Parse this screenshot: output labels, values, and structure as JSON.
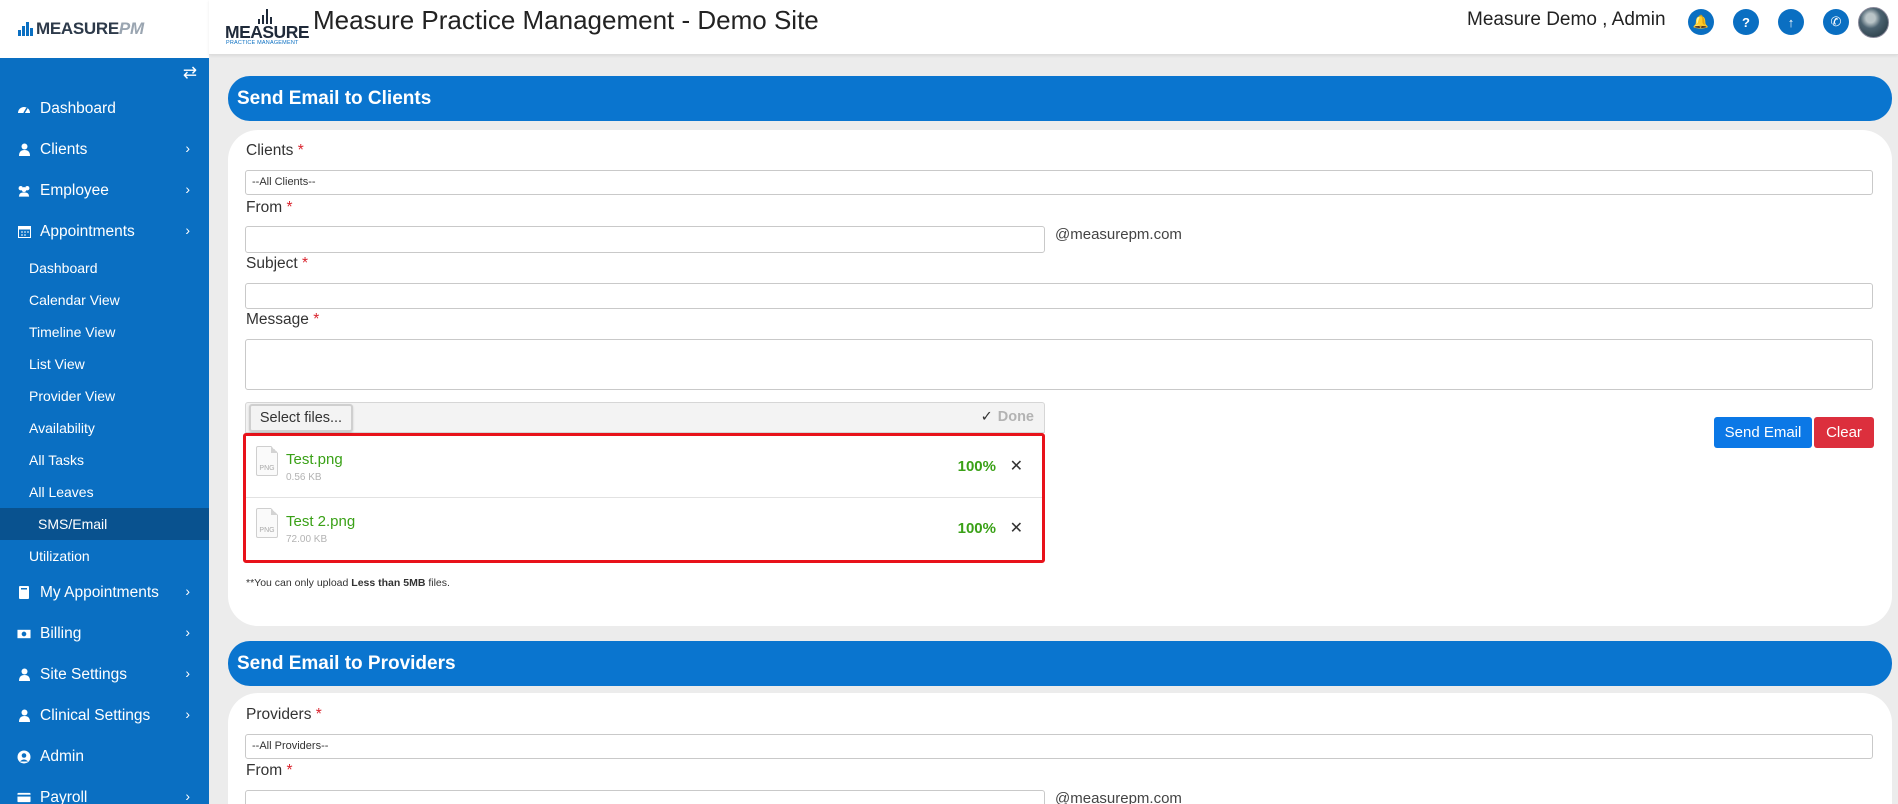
{
  "app": {
    "sidebar_logo_main": "MEASURE",
    "sidebar_logo_accent": "PM",
    "header_logo_main": "MEASURE",
    "header_logo_sub": "PRACTICE MANAGEMENT",
    "title": "Measure Practice Management - Demo Site",
    "user": "Measure Demo , Admin"
  },
  "header_icons": [
    {
      "icon": "bell-icon",
      "glyph": "🔔"
    },
    {
      "icon": "help-icon",
      "glyph": "?"
    },
    {
      "icon": "upload-icon",
      "glyph": "↑"
    },
    {
      "icon": "phone-icon",
      "glyph": "✆"
    }
  ],
  "sidebar": {
    "items": [
      {
        "label": "Dashboard",
        "icon": "dashboard-icon"
      },
      {
        "label": "Clients",
        "icon": "user-icon"
      },
      {
        "label": "Employee",
        "icon": "users-icon"
      },
      {
        "label": "Appointments",
        "icon": "calendar-icon"
      }
    ],
    "sub_items": [
      {
        "label": "Dashboard"
      },
      {
        "label": "Calendar View"
      },
      {
        "label": "Timeline View"
      },
      {
        "label": "List View"
      },
      {
        "label": "Provider View"
      },
      {
        "label": "Availability"
      },
      {
        "label": "All Tasks"
      },
      {
        "label": "All Leaves"
      },
      {
        "label": "SMS/Email"
      },
      {
        "label": "Utilization"
      }
    ],
    "items_after": [
      {
        "label": "My Appointments",
        "icon": "book-icon"
      },
      {
        "label": "Billing",
        "icon": "money-icon"
      },
      {
        "label": "Site Settings",
        "icon": "user-icon"
      },
      {
        "label": "Clinical Settings",
        "icon": "user-icon"
      },
      {
        "label": "Admin",
        "icon": "user-circle-icon"
      },
      {
        "label": "Payroll",
        "icon": "credit-card-icon"
      }
    ]
  },
  "clients_section": {
    "title": "Send Email to Clients",
    "clients_label": "Clients",
    "clients_value": "--All Clients--",
    "from_label": "From",
    "from_value": "",
    "domain": "@measurepm.com",
    "subject_label": "Subject",
    "subject_value": "",
    "message_label": "Message",
    "message_value": "",
    "required_mark": "*",
    "select_files": "Select files...",
    "done": "Done",
    "files": [
      {
        "name": "Test.png",
        "size": "0.56 KB",
        "progress": "100%",
        "type": "PNG"
      },
      {
        "name": "Test 2.png",
        "size": "72.00 KB",
        "progress": "100%",
        "type": "PNG"
      }
    ],
    "note_prefix": "**You can only upload ",
    "note_bold": "Less than 5MB",
    "note_suffix": " files.",
    "send_button": "Send Email",
    "clear_button": "Clear"
  },
  "providers_section": {
    "title": "Send Email to Providers",
    "providers_label": "Providers",
    "providers_value": "--All Providers--",
    "from_label": "From",
    "domain": "@measurepm.com",
    "required_mark": "*"
  },
  "colors": {
    "sidebar": "#0a6fc2",
    "section_bar": "#0a75cf",
    "send_button": "#0b78e6",
    "clear_button": "#dc2f3d",
    "upload_success": "#3aa117",
    "highlight_border": "#e8121a"
  }
}
